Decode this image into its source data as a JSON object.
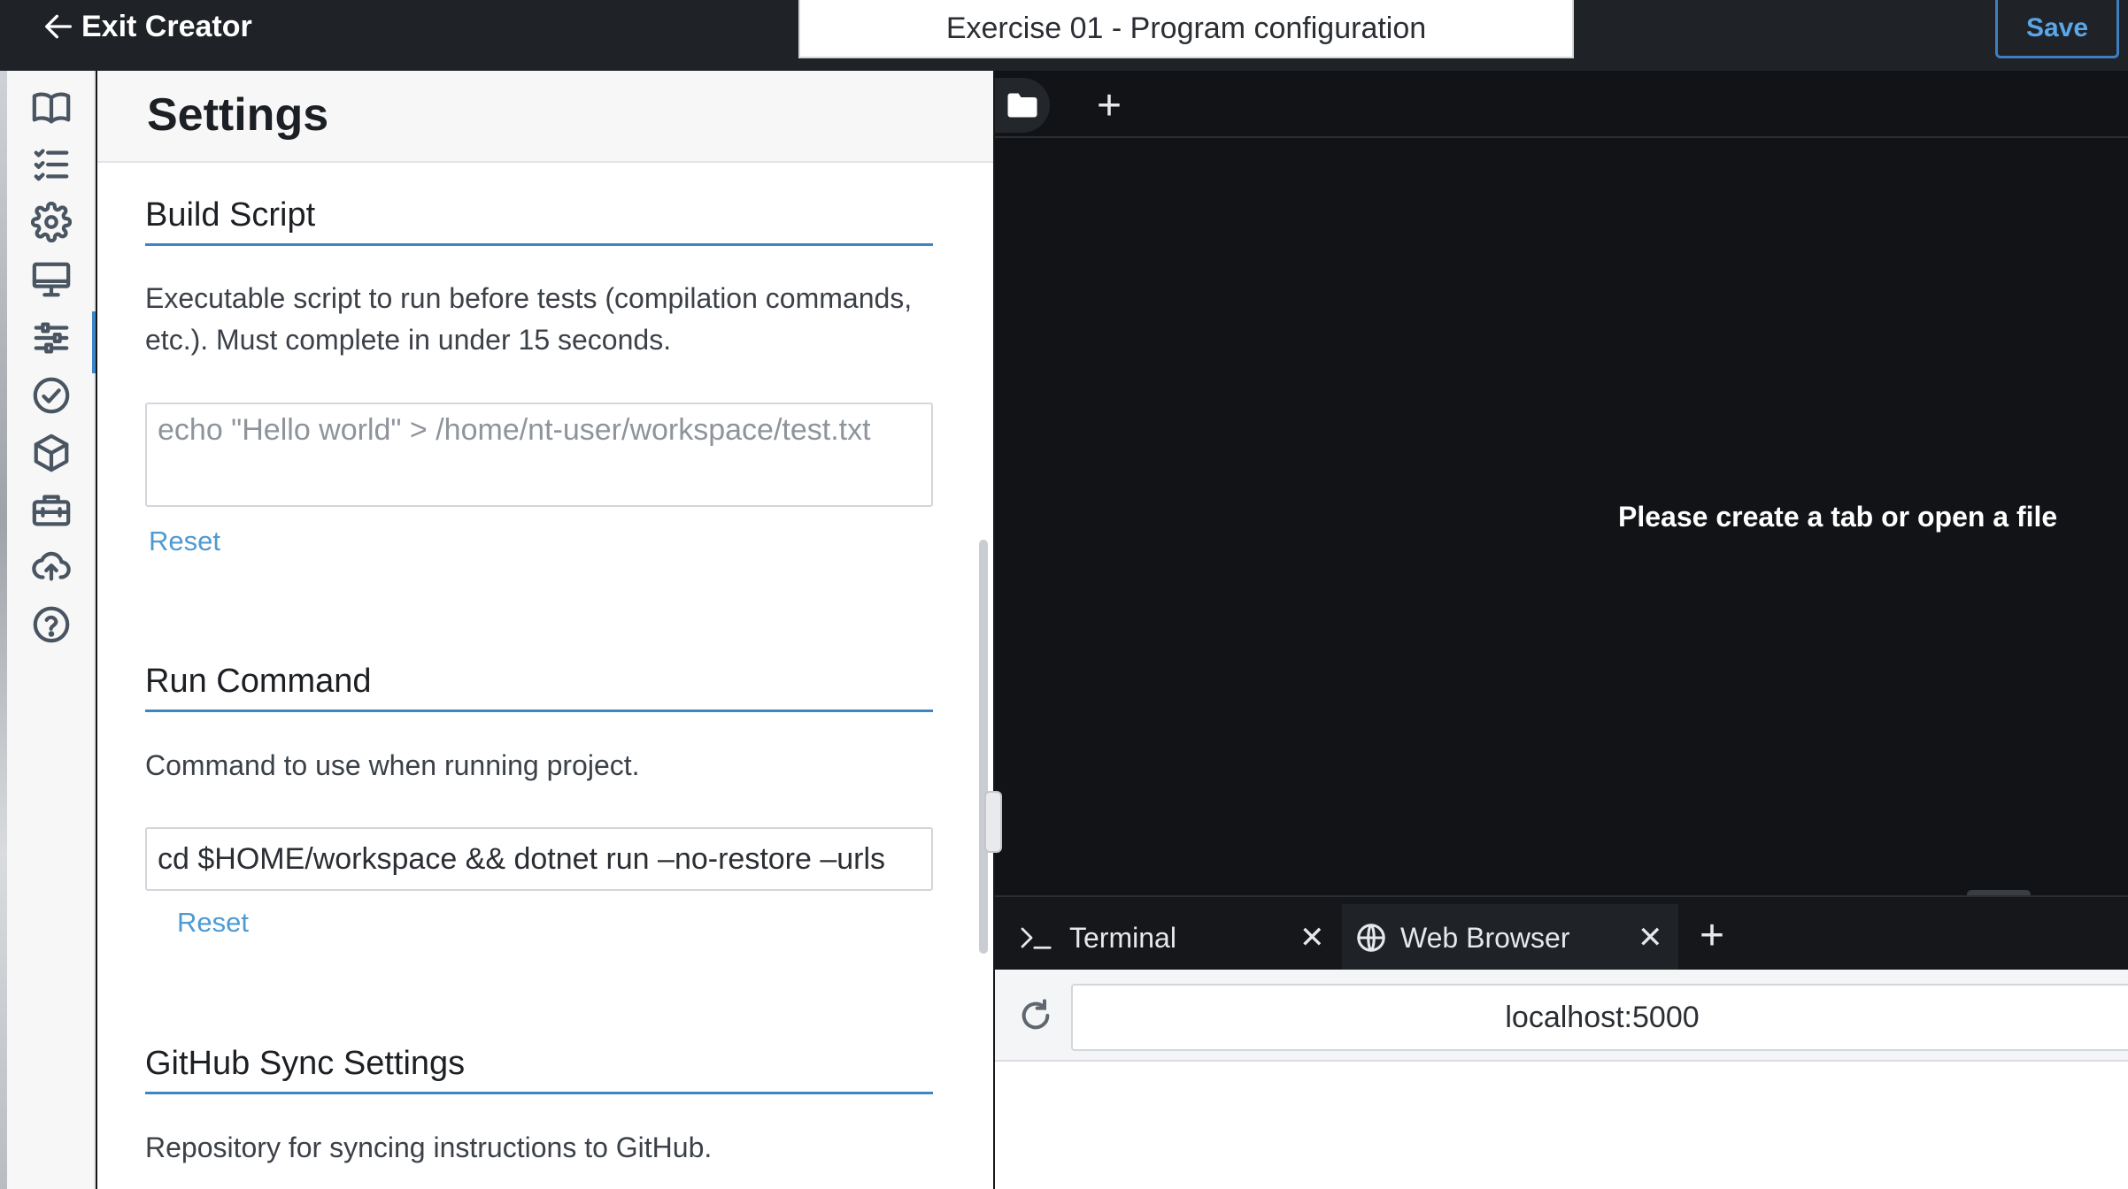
{
  "topbar": {
    "exit_label": "Exit Creator",
    "title": "Exercise 01 - Program configuration",
    "save_label": "Save"
  },
  "rail": {
    "icons": [
      "book-icon",
      "checklist-icon",
      "gear-icon",
      "monitor-icon",
      "sliders-icon",
      "check-circle-icon",
      "cube-icon",
      "toolbox-icon",
      "cloud-upload-icon",
      "help-circle-icon"
    ],
    "active": "sliders-icon"
  },
  "settings": {
    "title": "Settings",
    "build_script": {
      "title": "Build Script",
      "description": "Executable script to run before tests (compilation commands, etc.). Must complete in under 15 seconds.",
      "placeholder": "echo \"Hello world\" > /home/nt-user/workspace/test.txt",
      "value": "",
      "reset_label": "Reset"
    },
    "run_command": {
      "title": "Run Command",
      "description": "Command to use when running project.",
      "value": "cd $HOME/workspace && dotnet run –no-restore –urls",
      "reset_label": "Reset"
    },
    "github_sync": {
      "title": "GitHub Sync Settings",
      "description": "Repository for syncing instructions to GitHub."
    }
  },
  "editor": {
    "empty_message": "Please create a tab or open a file",
    "add_tab_symbol": "+"
  },
  "bottom_panel": {
    "tabs": [
      {
        "label": "Terminal",
        "icon": "terminal-icon",
        "active": false
      },
      {
        "label": "Web Browser",
        "icon": "globe-icon",
        "active": true
      }
    ],
    "close_symbol": "✕",
    "add_symbol": "+"
  },
  "browser": {
    "url": "localhost:5000"
  },
  "colors": {
    "accent": "#3d86c6",
    "link": "#4e9ad2",
    "topbar_bg": "#1f2226",
    "editor_bg": "#121316"
  }
}
